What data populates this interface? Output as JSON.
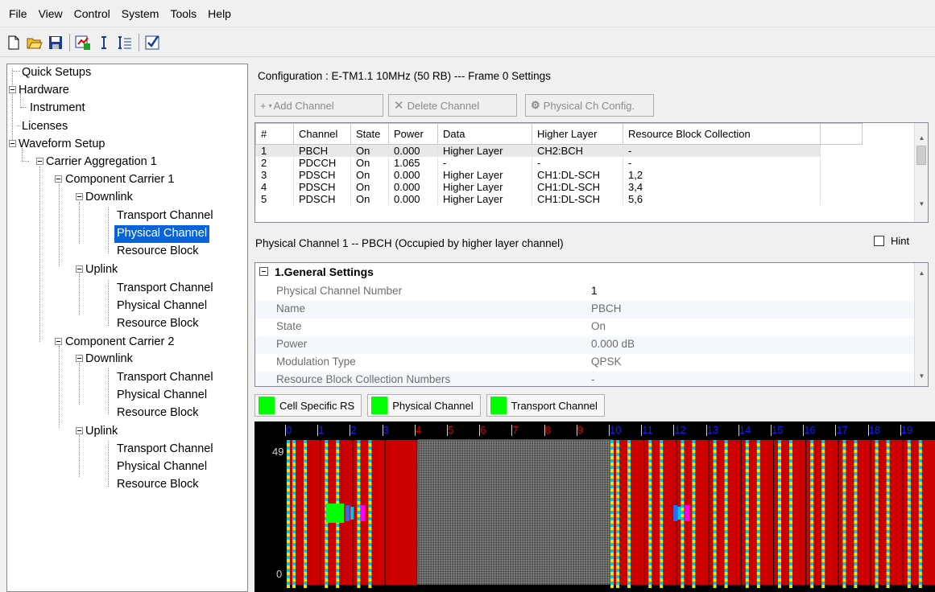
{
  "menu": [
    "File",
    "View",
    "Control",
    "System",
    "Tools",
    "Help"
  ],
  "toolbar_icons": [
    "new-file-icon",
    "open-folder-icon",
    "save-icon",
    "export-icon",
    "insert-icon",
    "list-icon",
    "checklist-icon"
  ],
  "tree": {
    "quick_setups": "Quick Setups",
    "hardware": "Hardware",
    "instrument": "Instrument",
    "licenses": "Licenses",
    "waveform_setup": "Waveform Setup",
    "carrier_aggregation": "Carrier Aggregation 1",
    "cc1": "Component Carrier 1",
    "cc2": "Component Carrier 2",
    "downlink": "Downlink",
    "uplink": "Uplink",
    "transport": "Transport Channel",
    "physical": "Physical Channel",
    "resource": "Resource Block"
  },
  "config_title": "Configuration : E-TM1.1 10MHz (50 RB) --- Frame 0 Settings",
  "buttons": {
    "add": "Add Channel",
    "delete": "Delete Channel",
    "config": "Physical Ch Config."
  },
  "table": {
    "columns": [
      "#",
      "Channel",
      "State",
      "Power",
      "Data",
      "Higher Layer",
      "Resource Block Collection"
    ],
    "rows": [
      [
        "1",
        "PBCH",
        "On",
        "0.000",
        "Higher Layer",
        "CH2:BCH",
        "-"
      ],
      [
        "2",
        "PDCCH",
        "On",
        "1.065",
        "-",
        "-",
        "-"
      ],
      [
        "3",
        "PDSCH",
        "On",
        "0.000",
        "Higher Layer",
        "CH1:DL-SCH",
        "1,2"
      ],
      [
        "4",
        "PDSCH",
        "On",
        "0.000",
        "Higher Layer",
        "CH1:DL-SCH",
        "3,4"
      ],
      [
        "5",
        "PDSCH",
        "On",
        "0.000",
        "Higher Layer",
        "CH1:DL-SCH",
        "5,6"
      ]
    ]
  },
  "phys_title": "Physical Channel 1 -- PBCH (Occupied by higher layer channel)",
  "hint": "Hint",
  "props": {
    "category": "1.General Settings",
    "rows": [
      {
        "k": "Physical Channel Number",
        "v": "1"
      },
      {
        "k": "Name",
        "v": "PBCH"
      },
      {
        "k": "State",
        "v": "On"
      },
      {
        "k": "Power",
        "v": "0.000 dB"
      },
      {
        "k": "Modulation Type",
        "v": "QPSK"
      },
      {
        "k": "Resource Block Collection Numbers",
        "v": "-"
      }
    ]
  },
  "legend": [
    {
      "label": "Cell Specific RS",
      "color": "#00ff00"
    },
    {
      "label": "Physical Channel",
      "color": "#00ff00"
    },
    {
      "label": "Transport Channel",
      "color": "#00ff00"
    }
  ],
  "map": {
    "slots": [
      "0",
      "1",
      "2",
      "3",
      "4",
      "5",
      "6",
      "7",
      "8",
      "9",
      "10",
      "11",
      "12",
      "13",
      "14",
      "15",
      "16",
      "17",
      "18",
      "19"
    ],
    "y_top": "49",
    "y_bottom": "0",
    "colors": {
      "red": "#cc0000",
      "cyan": "#00c8e6",
      "yellow": "#e8e800",
      "green": "#00ff00",
      "blue": "#1e6eff",
      "magenta": "#ff00ff",
      "gray": "#8a8a8a"
    }
  }
}
